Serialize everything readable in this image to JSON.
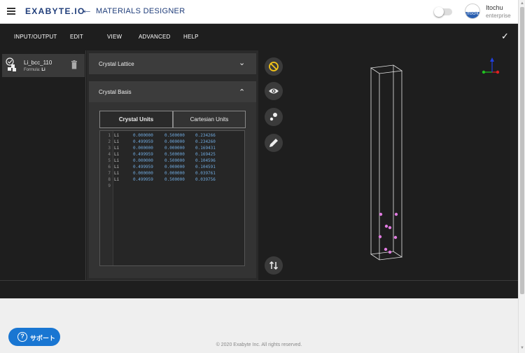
{
  "topbar": {
    "logo": "EXABYTE.IO",
    "app_title": "MATERIALS DESIGNER",
    "user_name": "Itochu",
    "user_plan": "enterprise",
    "avatar_text": "ITOCHU"
  },
  "menu": {
    "items": [
      "INPUT/OUTPUT",
      "EDIT",
      "VIEW",
      "ADVANCED",
      "HELP"
    ]
  },
  "material": {
    "name": "Li_bcc_110",
    "formula_label": "Formula:",
    "formula": "Li"
  },
  "panels": {
    "lattice_title": "Crystal Lattice",
    "basis_title": "Crystal Basis",
    "tabs": [
      "Crystal Units",
      "Cartesian Units"
    ],
    "active_tab": "Crystal Units"
  },
  "basis": {
    "lines": [
      {
        "n": "1",
        "el": "Li",
        "x": "0.000000",
        "y": "0.500000",
        "z": "0.234266"
      },
      {
        "n": "2",
        "el": "Li",
        "x": "0.499959",
        "y": "0.000000",
        "z": "0.234260"
      },
      {
        "n": "3",
        "el": "Li",
        "x": "0.000000",
        "y": "0.000000",
        "z": "0.169431"
      },
      {
        "n": "4",
        "el": "Li",
        "x": "0.499959",
        "y": "0.500000",
        "z": "0.169425"
      },
      {
        "n": "5",
        "el": "Li",
        "x": "0.000000",
        "y": "0.500000",
        "z": "0.104596"
      },
      {
        "n": "6",
        "el": "Li",
        "x": "0.499959",
        "y": "0.000000",
        "z": "0.104591"
      },
      {
        "n": "7",
        "el": "Li",
        "x": "0.000000",
        "y": "0.000000",
        "z": "0.039761"
      },
      {
        "n": "8",
        "el": "Li",
        "x": "0.499959",
        "y": "0.500000",
        "z": "0.039756"
      },
      {
        "n": "9",
        "el": "",
        "x": "",
        "y": "",
        "z": ""
      }
    ]
  },
  "viewer": {
    "tools": [
      "disable-icon",
      "eye-icon",
      "atoms-icon",
      "pencil-icon",
      "swap-vertical-icon"
    ],
    "atom_color": "#e07be0",
    "axis_colors": {
      "x": "#e02020",
      "y": "#20c020",
      "z": "#2040e0"
    }
  },
  "footer": {
    "support_label": "サポート",
    "support_icon": "?",
    "copyright": "© 2020 Exabyte Inc. All rights reserved."
  },
  "colors": {
    "accent": "#1976d2",
    "brand": "#1f3d7a",
    "dark_bg": "#1e1e1e"
  }
}
